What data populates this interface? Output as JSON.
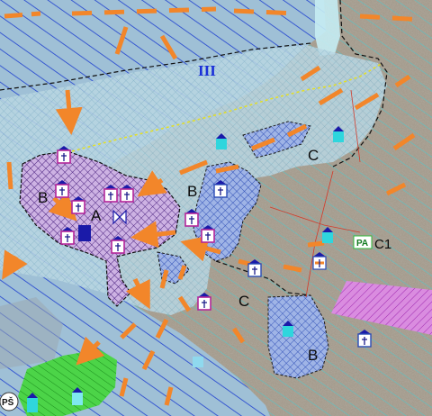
{
  "map": {
    "zone_labels": [
      {
        "id": "zone-a",
        "text": "A"
      },
      {
        "id": "zone-b-west",
        "text": "B"
      },
      {
        "id": "zone-b-center",
        "text": "B"
      },
      {
        "id": "zone-b-south",
        "text": "B"
      },
      {
        "id": "zone-c-north",
        "text": "C"
      },
      {
        "id": "zone-c-south",
        "text": "C"
      },
      {
        "id": "zone-c1",
        "text": "C1"
      }
    ],
    "area_labels": {
      "sea_zone": "III",
      "pa_box": "PA",
      "ps_circle": "PŠ"
    },
    "colors": {
      "sea_hatch": "#1e3fd0",
      "land_hatch": "#3ed0d8",
      "core_crosshatch": "#7a2fa0",
      "buffer_crosshatch": "#2b4bb5",
      "arrows": "#f2862a",
      "church_icon": "#b3269a",
      "boundary_dashed": "#111111",
      "path_yellow": "#e6e020",
      "green_zone": "#38c83a",
      "magenta_band": "#c646d6"
    },
    "icons": [
      "church-icon",
      "fort-icon",
      "cyan-marker-icon",
      "cross-marker-icon"
    ]
  }
}
